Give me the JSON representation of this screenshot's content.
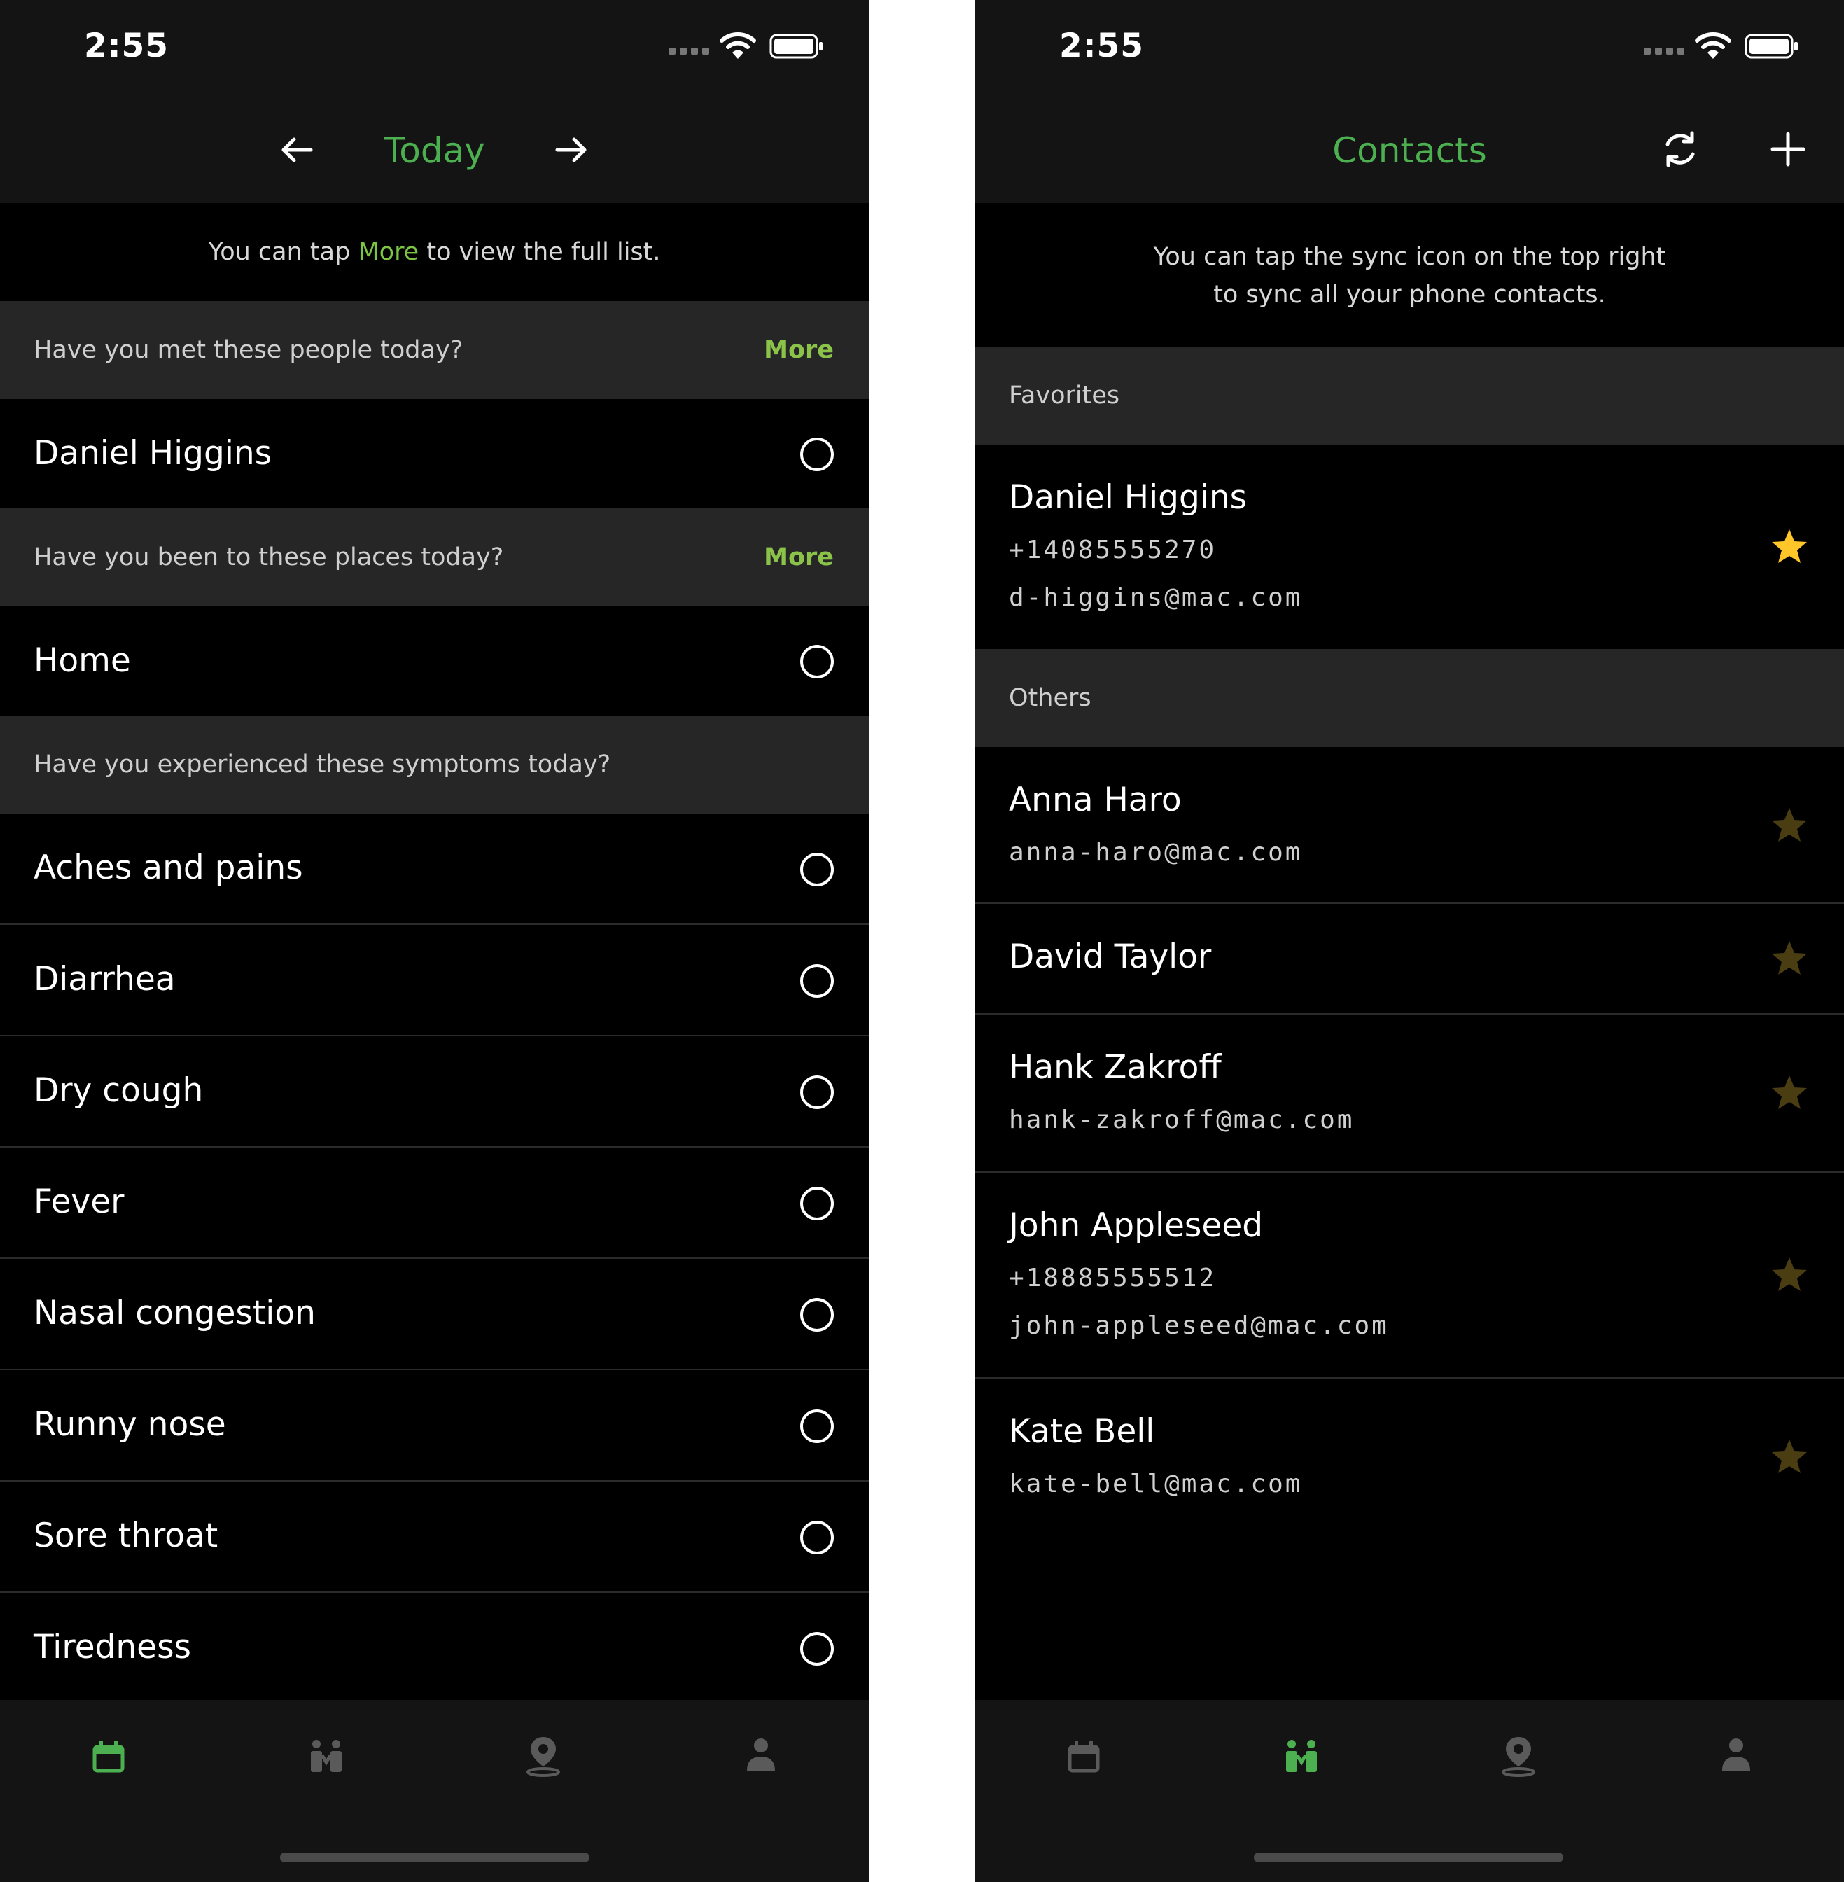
{
  "left": {
    "status": {
      "time": "2:55"
    },
    "nav": {
      "title": "Today"
    },
    "hint": {
      "prefix": "You can tap ",
      "accent": "More",
      "suffix": " to view the full list."
    },
    "people_section": {
      "label": "Have you met these people today?",
      "more": "More"
    },
    "people": [
      {
        "name": "Daniel Higgins"
      }
    ],
    "places_section": {
      "label": "Have you been to these places today?",
      "more": "More"
    },
    "places": [
      {
        "name": "Home"
      }
    ],
    "symptoms_section": {
      "label": "Have you experienced these symptoms today?"
    },
    "symptoms": [
      {
        "name": "Aches and pains"
      },
      {
        "name": "Diarrhea"
      },
      {
        "name": "Dry cough"
      },
      {
        "name": "Fever"
      },
      {
        "name": "Nasal congestion"
      },
      {
        "name": "Runny nose"
      },
      {
        "name": "Sore throat"
      },
      {
        "name": "Tiredness"
      }
    ],
    "tabs": {
      "active": "calendar"
    }
  },
  "right": {
    "status": {
      "time": "2:55"
    },
    "nav": {
      "title": "Contacts"
    },
    "hint": {
      "line1": "You can tap the sync icon on the top right",
      "line2": "to sync all your phone contacts."
    },
    "favorites_section": {
      "label": "Favorites"
    },
    "favorites": [
      {
        "name": "Daniel Higgins",
        "phone": "+14085555270",
        "email": "d-higgins@mac.com",
        "favorite": true
      }
    ],
    "others_section": {
      "label": "Others"
    },
    "others": [
      {
        "name": "Anna Haro",
        "email": "anna-haro@mac.com",
        "favorite": false
      },
      {
        "name": "David Taylor",
        "favorite": false
      },
      {
        "name": "Hank Zakroff",
        "email": "hank-zakroff@mac.com",
        "favorite": false
      },
      {
        "name": "John Appleseed",
        "phone": "+18885555512",
        "email": "john-appleseed@mac.com",
        "favorite": false
      },
      {
        "name": "Kate Bell",
        "email": "kate-bell@mac.com",
        "favorite": false
      }
    ],
    "tabs": {
      "active": "people"
    }
  },
  "colors": {
    "accent": "#4caf50",
    "more_link": "#8bc34a",
    "star_active": "#ffc629",
    "star_inactive": "#4a3d12",
    "tab_inactive": "#5a5a5a"
  }
}
